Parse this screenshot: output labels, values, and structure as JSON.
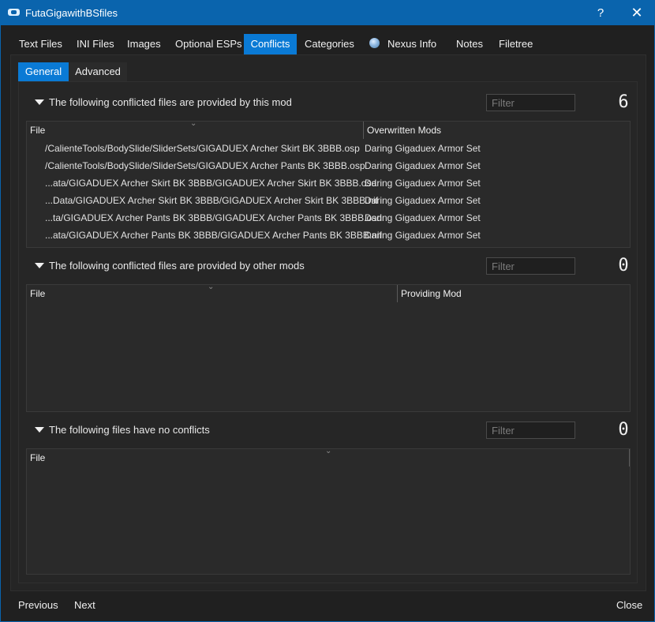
{
  "window": {
    "title": "FutaGigawithBSfiles",
    "help": "?",
    "close": "✕"
  },
  "tabs": [
    "Text Files",
    "INI Files",
    "Images",
    "Optional ESPs",
    "Conflicts",
    "Categories",
    "Nexus Info",
    "Notes",
    "Filetree"
  ],
  "active_tab": "Conflicts",
  "subtabs": [
    "General",
    "Advanced"
  ],
  "active_subtab": "General",
  "sections": {
    "provided": {
      "title": "The following conflicted files are provided by this mod",
      "filter_placeholder": "Filter",
      "count": "6",
      "columns": [
        "File",
        "Overwritten Mods"
      ],
      "rows": [
        {
          "file": "/CalienteTools/BodySlide/SliderSets/GIGADUEX Archer Skirt BK 3BBB.osp",
          "mod": "Daring Gigaduex Armor Set"
        },
        {
          "file": "/CalienteTools/BodySlide/SliderSets/GIGADUEX Archer Pants BK 3BBB.osp",
          "mod": "Daring Gigaduex Armor Set"
        },
        {
          "file": "...ata/GIGADUEX Archer Skirt BK 3BBB/GIGADUEX Archer Skirt BK 3BBB.osd",
          "mod": "Daring Gigaduex Armor Set"
        },
        {
          "file": "...Data/GIGADUEX Archer Skirt BK 3BBB/GIGADUEX Archer Skirt BK 3BBB.nif",
          "mod": "Daring Gigaduex Armor Set"
        },
        {
          "file": "...ta/GIGADUEX Archer Pants BK 3BBB/GIGADUEX Archer Pants BK 3BBB.osd",
          "mod": "Daring Gigaduex Armor Set"
        },
        {
          "file": "...ata/GIGADUEX Archer Pants BK 3BBB/GIGADUEX Archer Pants BK 3BBB.nif",
          "mod": "Daring Gigaduex Armor Set"
        }
      ]
    },
    "other": {
      "title": "The following conflicted files are provided by other mods",
      "filter_placeholder": "Filter",
      "count": "0",
      "columns": [
        "File",
        "Providing Mod"
      ]
    },
    "none": {
      "title": "The following files have no conflicts",
      "filter_placeholder": "Filter",
      "count": "0",
      "columns": [
        "File"
      ]
    }
  },
  "footer": {
    "previous": "Previous",
    "next": "Next",
    "close": "Close"
  }
}
